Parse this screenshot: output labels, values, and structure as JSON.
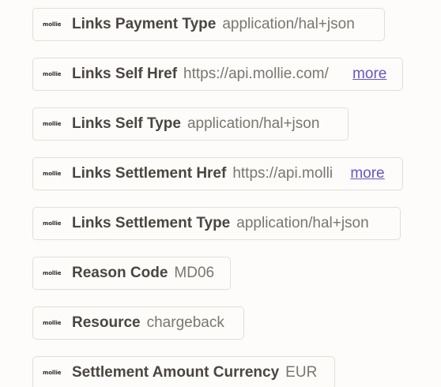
{
  "app_logo_text": "mollie",
  "more_label": "more",
  "fields": [
    {
      "label": "Links Payment Type",
      "value": "application/hal+json"
    },
    {
      "label": "Links Self Href",
      "value": "https://api.mollie.com/"
    },
    {
      "label": "Links Self Type",
      "value": "application/hal+json"
    },
    {
      "label": "Links Settlement Href",
      "value": "https://api.molli"
    },
    {
      "label": "Links Settlement Type",
      "value": "application/hal+json"
    },
    {
      "label": "Reason Code",
      "value": "MD06"
    },
    {
      "label": "Resource",
      "value": "chargeback"
    },
    {
      "label": "Settlement Amount Currency",
      "value": "EUR"
    }
  ]
}
